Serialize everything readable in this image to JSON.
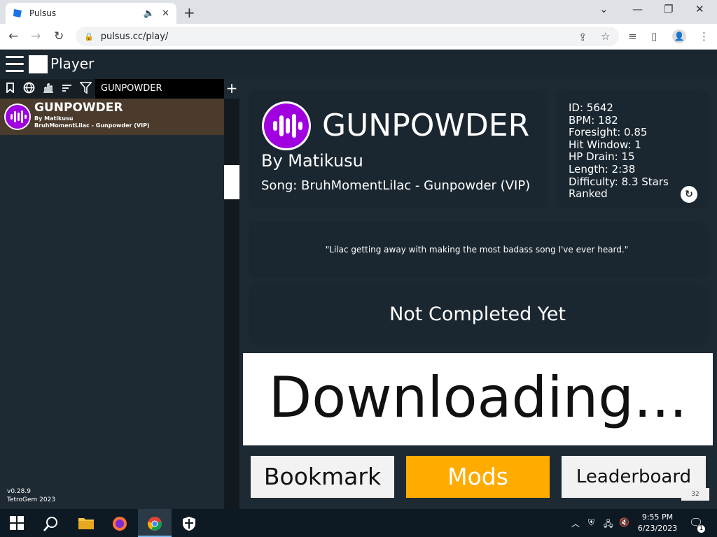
{
  "browser": {
    "tab_title": "Pulsus",
    "url": "pulsus.cc/play/",
    "new_tab_label": "+"
  },
  "app": {
    "title": "Player",
    "version": "v0.28.9",
    "copyright": "TetroGem 2023"
  },
  "left": {
    "search_value": "GUNPOWDER",
    "add_label": "+",
    "song": {
      "name": "GUNPOWDER",
      "by": "By Matikusu",
      "song": "BruhMomentLilac - Gunpowder (VIP)"
    }
  },
  "detail": {
    "title": "GUNPOWDER",
    "by": "By Matikusu",
    "song": "Song: BruhMomentLilac - Gunpowder (VIP)",
    "stats": [
      "ID: 5642",
      "BPM: 182",
      "Foresight: 0.85",
      "Hit Window: 1",
      "HP Drain: 15",
      "Length: 2:38",
      "Difficulty: 8.3 Stars",
      "Ranked"
    ],
    "quote": "\"Lilac getting away with making the most badass song I've ever heard.\"",
    "status": "Not Completed Yet",
    "downloading": "Downloading...",
    "buttons": {
      "bookmark": "Bookmark",
      "mods": "Mods",
      "leaderboard": "Leaderboard"
    },
    "counter": "32"
  },
  "taskbar": {
    "time": "9:55 PM",
    "date": "6/23/2023",
    "notifications": "1"
  },
  "colors": {
    "accent": "#a000e0",
    "mods": "#ffab00",
    "panel": "#1b2730",
    "background": "#1e2a33",
    "selected": "#4a3b2c"
  }
}
